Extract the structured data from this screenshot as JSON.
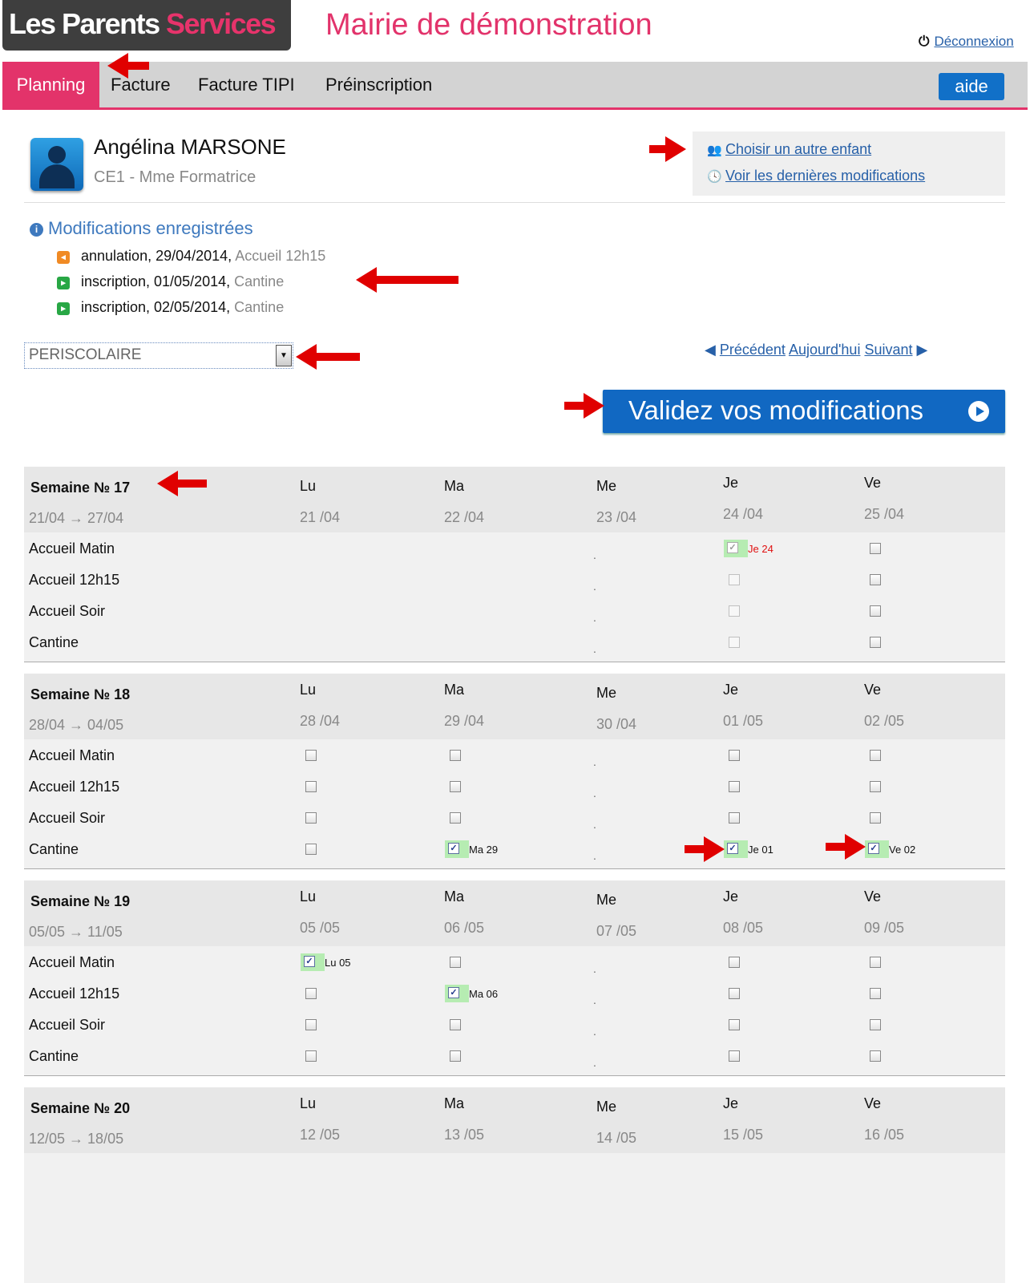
{
  "header": {
    "logo_part1": "Les Parents",
    "logo_part2": "Services",
    "mairie_title": "Mairie de démonstration",
    "logout_label": "Déconnexion"
  },
  "nav": {
    "tabs": [
      {
        "label": "Planning",
        "active": true
      },
      {
        "label": "Facture"
      },
      {
        "label": "Facture TIPI"
      },
      {
        "label": "Préinscription"
      }
    ],
    "help_label": "aide"
  },
  "child": {
    "name": "Angélina MARSONE",
    "class": "CE1 - Mme Formatrice",
    "links": {
      "choose_other": "Choisir un autre enfant",
      "last_changes": "Voir les dernières modifications"
    }
  },
  "modifications": {
    "title": "Modifications enregistrées",
    "items": [
      {
        "action": "annulation, 29/04/2014,",
        "service": "Accueil 12h15",
        "kind": "cancel"
      },
      {
        "action": "inscription, 01/05/2014,",
        "service": "Cantine",
        "kind": "add"
      },
      {
        "action": "inscription, 02/05/2014,",
        "service": "Cantine",
        "kind": "add"
      }
    ]
  },
  "activity_select": {
    "value": "PERISCOLAIRE"
  },
  "pager": {
    "prev": "Précédent",
    "today": "Aujourd'hui",
    "next": "Suivant"
  },
  "validate_label": "Validez vos modifications",
  "colors": {
    "brand_pink": "#e3336a",
    "primary_blue": "#1168c2",
    "link_blue": "#2760a8",
    "checked_bg": "#b6ecb2"
  },
  "rows": [
    "Accueil Matin",
    "Accueil 12h15",
    "Accueil Soir",
    "Cantine"
  ],
  "weeks": [
    {
      "title": "Semaine № 17",
      "range": "21/04 → 27/04",
      "days": [
        {
          "name": "Lu",
          "date": "21 /04",
          "cells": [
            "none",
            "none",
            "none",
            "none"
          ]
        },
        {
          "name": "Ma",
          "date": "22 /04",
          "cells": [
            "none",
            "none",
            "none",
            "none"
          ]
        },
        {
          "name": "Me",
          "date": "23 /04",
          "cells": [
            "dot",
            "dot",
            "dot",
            "dot"
          ]
        },
        {
          "name": "Je",
          "date": "24 /04",
          "cells": [
            {
              "state": "checked-disabled",
              "label": "Je 24"
            },
            "disabled",
            "disabled",
            "disabled"
          ]
        },
        {
          "name": "Ve",
          "date": "25 /04",
          "cells": [
            "box",
            "box",
            "box",
            "box"
          ]
        }
      ]
    },
    {
      "title": "Semaine № 18",
      "range": "28/04 → 04/05",
      "days": [
        {
          "name": "Lu",
          "date": "28 /04",
          "cells": [
            "box",
            "box",
            "box",
            "box"
          ]
        },
        {
          "name": "Ma",
          "date": "29 /04",
          "cells": [
            "box",
            "box",
            "box",
            {
              "state": "checked",
              "label": "Ma 29"
            }
          ]
        },
        {
          "name": "Me",
          "date": "30 /04",
          "cells": [
            "dot",
            "dot",
            "dot",
            "dot"
          ]
        },
        {
          "name": "Je",
          "date": "01 /05",
          "cells": [
            "box",
            "box",
            "box",
            {
              "state": "checked",
              "label": "Je 01"
            }
          ]
        },
        {
          "name": "Ve",
          "date": "02 /05",
          "cells": [
            "box",
            "box",
            "box",
            {
              "state": "checked",
              "label": "Ve 02"
            }
          ]
        }
      ]
    },
    {
      "title": "Semaine № 19",
      "range": "05/05 → 11/05",
      "days": [
        {
          "name": "Lu",
          "date": "05 /05",
          "cells": [
            {
              "state": "checked",
              "label": "Lu 05"
            },
            "box",
            "box",
            "box"
          ]
        },
        {
          "name": "Ma",
          "date": "06 /05",
          "cells": [
            "box",
            {
              "state": "checked",
              "label": "Ma 06"
            },
            "box",
            "box"
          ]
        },
        {
          "name": "Me",
          "date": "07 /05",
          "cells": [
            "dot",
            "dot",
            "dot",
            "dot"
          ]
        },
        {
          "name": "Je",
          "date": "08 /05",
          "cells": [
            "box",
            "box",
            "box",
            "box"
          ]
        },
        {
          "name": "Ve",
          "date": "09 /05",
          "cells": [
            "box",
            "box",
            "box",
            "box"
          ]
        }
      ]
    },
    {
      "title": "Semaine № 20",
      "range": "12/05 → 18/05",
      "days": [
        {
          "name": "Lu",
          "date": "12 /05",
          "cells": []
        },
        {
          "name": "Ma",
          "date": "13 /05",
          "cells": []
        },
        {
          "name": "Me",
          "date": "14 /05",
          "cells": []
        },
        {
          "name": "Je",
          "date": "15 /05",
          "cells": []
        },
        {
          "name": "Ve",
          "date": "16 /05",
          "cells": []
        }
      ]
    }
  ]
}
